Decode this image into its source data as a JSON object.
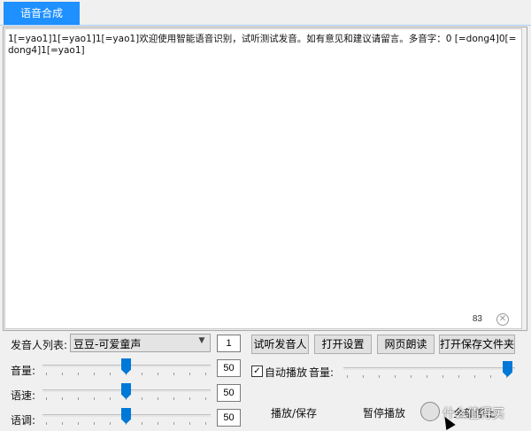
{
  "tab": {
    "label": "语音合成"
  },
  "editor": {
    "text": "1[=yao1]1[=yao1]1[=yao1]欢迎使用智能语音识别，试听测试发音。如有意见和建议请留言。多音字：0 [=dong4]0[=dong4]1[=yao1]",
    "char_count": "83",
    "clear_icon": "clear-circle-icon"
  },
  "voice": {
    "label": "发音人列表:",
    "selected": "豆豆-可爱童声",
    "count": "1"
  },
  "buttons": {
    "preview_voice": "试听发音人",
    "open_settings": "打开设置",
    "web_read": "网页朗读",
    "open_save_folder": "打开保存文件夹"
  },
  "sliders": {
    "volume_label": "音量:",
    "volume_value": "50",
    "speed_label": "语速:",
    "speed_value": "50",
    "pitch_label": "语调:",
    "pitch_value": "50",
    "playback_volume_label": "音量:"
  },
  "autoplay": {
    "label": "自动播放",
    "checked": true
  },
  "actions": {
    "play_save": "播放/保存",
    "pause_play": "暂停播放",
    "stop_all": "全部停止"
  },
  "watermark": {
    "text": "什么值得买"
  }
}
